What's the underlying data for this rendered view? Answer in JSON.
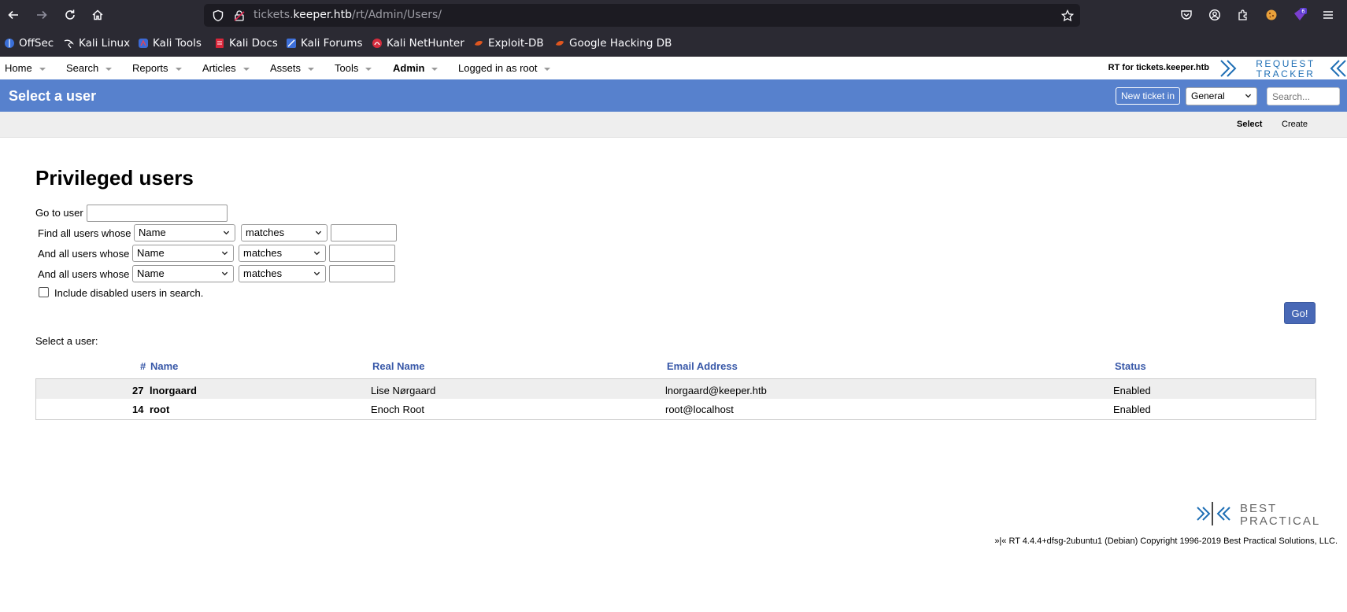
{
  "browser": {
    "url_host_prefix": "tickets.",
    "url_domain": "keeper.htb",
    "url_path": "/rt/Admin/Users/",
    "extension_badge": "6"
  },
  "bookmarks": [
    "OffSec",
    "Kali Linux",
    "Kali Tools",
    "Kali Docs",
    "Kali Forums",
    "Kali NetHunter",
    "Exploit-DB",
    "Google Hacking DB"
  ],
  "nav": {
    "items": [
      "Home",
      "Search",
      "Reports",
      "Articles",
      "Assets",
      "Tools",
      "Admin",
      "Logged in as root"
    ],
    "rt_for": "RT for tickets.keeper.htb",
    "logo_line1": "REQUEST",
    "logo_line2": "TRACKER"
  },
  "header": {
    "title": "Select a user",
    "new_ticket_label": "New ticket in",
    "queue_selected": "General",
    "search_placeholder": "Search..."
  },
  "page_menu": {
    "select": "Select",
    "create": "Create"
  },
  "content": {
    "heading": "Privileged users",
    "go_to_user": "Go to user",
    "find_label": "Find all users whose",
    "and_label": "And all users whose",
    "field_option": "Name",
    "op_option": "matches",
    "include_disabled": "Include disabled users in search.",
    "go_button": "Go!",
    "select_a_user": "Select a user:"
  },
  "table": {
    "headers": {
      "id": "#",
      "name": "Name",
      "real_name": "Real Name",
      "email": "Email Address",
      "status": "Status"
    },
    "rows": [
      {
        "id": "27",
        "name": "lnorgaard",
        "real_name": "Lise Nørgaard",
        "email": "lnorgaard@keeper.htb",
        "status": "Enabled"
      },
      {
        "id": "14",
        "name": "root",
        "real_name": "Enoch Root",
        "email": "root@localhost",
        "status": "Enabled"
      }
    ]
  },
  "footer": {
    "logo_line1": "BEST",
    "logo_line2": "PRACTICAL",
    "copyright": "»|« RT 4.4.4+dfsg-2ubuntu1 (Debian) Copyright 1996-2019 Best Practical Solutions, LLC."
  },
  "colors": {
    "header_blue": "#5781cd",
    "link_blue": "#3858a8",
    "go_button": "#4868b6",
    "chrome_dark": "#2b2a33"
  }
}
